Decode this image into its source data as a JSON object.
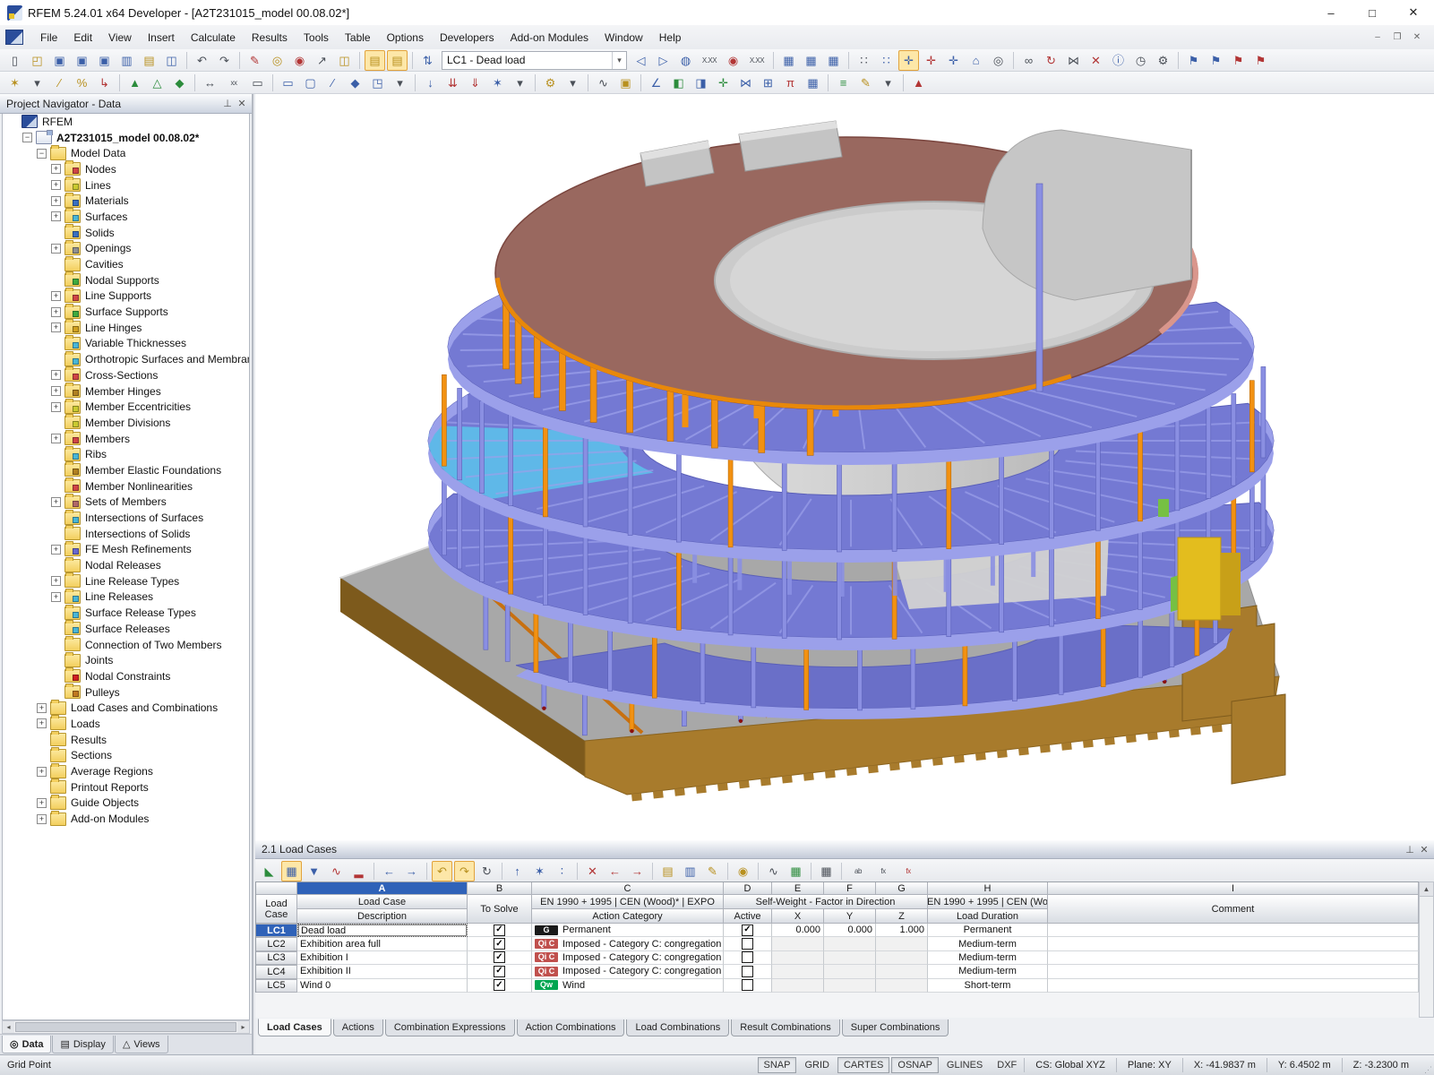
{
  "window": {
    "title": "RFEM 5.24.01 x64 Developer - [A2T231015_model 00.08.02*]",
    "controls": {
      "minimize": "–",
      "maximize": "□",
      "close": "✕"
    }
  },
  "menu": {
    "items": [
      "File",
      "Edit",
      "View",
      "Insert",
      "Calculate",
      "Results",
      "Tools",
      "Table",
      "Options",
      "Developers",
      "Add-on Modules",
      "Window",
      "Help"
    ]
  },
  "toolbar_main": {
    "combo_value": "LC1 - Dead load",
    "row1": [
      {
        "n": "new-file",
        "g": "▯",
        "c": "k"
      },
      {
        "n": "open-file",
        "g": "◰",
        "c": "y"
      },
      {
        "n": "save",
        "g": "▣",
        "c": "b"
      },
      {
        "n": "save-as",
        "g": "▣",
        "c": "b"
      },
      {
        "n": "save-all",
        "g": "▣",
        "c": "b"
      },
      {
        "n": "print",
        "g": "▥",
        "c": "b"
      },
      {
        "n": "copy",
        "g": "▤",
        "c": "y"
      },
      {
        "n": "print-preview",
        "g": "◫",
        "c": "b"
      },
      {
        "sep": 1
      },
      {
        "n": "undo",
        "g": "↶",
        "c": "k"
      },
      {
        "n": "redo",
        "g": "↷",
        "c": "k"
      },
      {
        "sep": 1
      },
      {
        "n": "edit-mode",
        "g": "✎",
        "c": "r"
      },
      {
        "n": "zoom-window",
        "g": "◎",
        "c": "y"
      },
      {
        "n": "zoom-point",
        "g": "◉",
        "c": "r"
      },
      {
        "n": "pick-objects",
        "g": "↗",
        "c": "k"
      },
      {
        "n": "new-window",
        "g": "◫",
        "c": "y"
      },
      {
        "sep": 1
      },
      {
        "n": "table-show",
        "g": "▤",
        "c": "y",
        "p": 1
      },
      {
        "n": "table-dock",
        "g": "▤",
        "c": "y",
        "p": 1
      },
      {
        "sep": 1
      },
      {
        "n": "loadcase-jump",
        "g": "⇅",
        "c": "b"
      },
      {
        "combo": 1
      },
      {
        "n": "prev-loadcase",
        "g": "◁",
        "c": "b"
      },
      {
        "n": "next-loadcase",
        "g": "▷",
        "c": "b"
      },
      {
        "n": "show-loads",
        "g": "◍",
        "c": "b"
      },
      {
        "n": "load-values",
        "g": "X.XX",
        "c": "k",
        "t": 1
      },
      {
        "n": "show-results",
        "g": "◉",
        "c": "r"
      },
      {
        "n": "result-values",
        "g": "X.XX",
        "c": "k",
        "t": 1
      },
      {
        "sep": 1
      },
      {
        "n": "panel-1",
        "g": "▦",
        "c": "b"
      },
      {
        "n": "panel-2",
        "g": "▦",
        "c": "b"
      },
      {
        "n": "panel-3",
        "g": "▦",
        "c": "b"
      },
      {
        "sep": 1
      },
      {
        "n": "fe-mesh",
        "g": "∷",
        "c": "k"
      },
      {
        "n": "fe-mesh-settings",
        "g": "∷",
        "c": "b"
      },
      {
        "n": "move-snap",
        "g": "✛",
        "c": "b",
        "p": 1
      },
      {
        "n": "move-grid",
        "g": "✛",
        "c": "r"
      },
      {
        "n": "move-object",
        "g": "✛",
        "c": "b"
      },
      {
        "n": "work-plane",
        "g": "⌂",
        "c": "b"
      },
      {
        "n": "plane-settings",
        "g": "◎",
        "c": "k"
      },
      {
        "sep": 1
      },
      {
        "n": "connect-members",
        "g": "∞",
        "c": "k"
      },
      {
        "n": "rotate-copy",
        "g": "↻",
        "c": "r"
      },
      {
        "n": "mirror",
        "g": "⋈",
        "c": "k"
      },
      {
        "n": "delete-results",
        "g": "✕",
        "c": "r"
      },
      {
        "n": "info",
        "g": "ⓘ",
        "c": "b"
      },
      {
        "n": "history",
        "g": "◷",
        "c": "k"
      },
      {
        "n": "settings-gears",
        "g": "⚙",
        "c": "k"
      },
      {
        "sep": 1
      },
      {
        "n": "import-load-1",
        "g": "⚑",
        "c": "b"
      },
      {
        "n": "import-load-2",
        "g": "⚑",
        "c": "b"
      },
      {
        "n": "export-load-1",
        "g": "⚑",
        "c": "r"
      },
      {
        "n": "export-load-2",
        "g": "⚑",
        "c": "r"
      }
    ],
    "row2": [
      {
        "n": "new-node",
        "g": "✶",
        "c": "y"
      },
      {
        "n": "new-node-dd",
        "g": "▾",
        "c": "k"
      },
      {
        "n": "new-line",
        "g": "∕",
        "c": "y"
      },
      {
        "n": "divide-line",
        "g": "%",
        "c": "y"
      },
      {
        "n": "line-polyline",
        "g": "↳",
        "c": "r"
      },
      {
        "sep": 1
      },
      {
        "n": "nodal-support",
        "g": "▲",
        "c": "g"
      },
      {
        "n": "line-support",
        "g": "△",
        "c": "g"
      },
      {
        "n": "surface-support",
        "g": "◆",
        "c": "g"
      },
      {
        "sep": 1
      },
      {
        "n": "dimension",
        "g": "↔",
        "c": "k"
      },
      {
        "n": "dimension-xx",
        "g": "xx",
        "c": "k",
        "t": 1
      },
      {
        "n": "selection-box",
        "g": "▭",
        "c": "k"
      },
      {
        "sep": 1
      },
      {
        "n": "new-surface",
        "g": "▭",
        "c": "b"
      },
      {
        "n": "new-opening",
        "g": "▢",
        "c": "b"
      },
      {
        "n": "new-member",
        "g": "∕",
        "c": "b"
      },
      {
        "n": "new-solid",
        "g": "◆",
        "c": "b"
      },
      {
        "n": "copy-object",
        "g": "◳",
        "c": "b"
      },
      {
        "n": "copy-dd",
        "g": "▾",
        "c": "k"
      },
      {
        "sep": 1
      },
      {
        "n": "nodal-load",
        "g": "↓",
        "c": "b"
      },
      {
        "n": "member-load",
        "g": "⇊",
        "c": "r"
      },
      {
        "n": "surface-load",
        "g": "⇓",
        "c": "r"
      },
      {
        "n": "generate-loads",
        "g": "✶",
        "c": "b"
      },
      {
        "n": "loads-dd",
        "g": "▾",
        "c": "k"
      },
      {
        "sep": 1
      },
      {
        "n": "tools-axes",
        "g": "⚙",
        "c": "y"
      },
      {
        "n": "tools-dd",
        "g": "▾",
        "c": "k"
      },
      {
        "sep": 1
      },
      {
        "n": "guide-line",
        "g": "∿",
        "c": "k"
      },
      {
        "n": "stamp",
        "g": "▣",
        "c": "y"
      },
      {
        "sep": 1
      },
      {
        "n": "measure",
        "g": "∠",
        "c": "b"
      },
      {
        "n": "render-surface",
        "g": "◧",
        "c": "g"
      },
      {
        "n": "render-solid",
        "g": "◨",
        "c": "b"
      },
      {
        "n": "move-arrows",
        "g": "✛",
        "c": "g"
      },
      {
        "n": "mirror-copy",
        "g": "⋈",
        "c": "b"
      },
      {
        "n": "multi-copy",
        "g": "⊞",
        "c": "b"
      },
      {
        "n": "section",
        "g": "π",
        "c": "r"
      },
      {
        "n": "table-view",
        "g": "▦",
        "c": "b"
      },
      {
        "sep": 1
      },
      {
        "n": "display-list",
        "g": "≡",
        "c": "g"
      },
      {
        "n": "format-brush",
        "g": "✎",
        "c": "y"
      },
      {
        "n": "brush-dd",
        "g": "▾",
        "c": "k"
      },
      {
        "sep": 1
      },
      {
        "n": "color-scale",
        "g": "▲",
        "c": "r"
      }
    ]
  },
  "navigator": {
    "title": "Project Navigator - Data",
    "pin_icon": "⊥",
    "close_icon": "✕",
    "tree": [
      [
        0,
        "RFEM",
        "none",
        "rfem",
        0
      ],
      [
        1,
        "A2T231015_model 00.08.02*",
        "minus",
        "model",
        1
      ],
      [
        2,
        "Model Data",
        "minus",
        "folderOpen",
        0
      ],
      [
        3,
        "Nodes",
        "plus",
        "nodes",
        0
      ],
      [
        3,
        "Lines",
        "plus",
        "lines",
        0
      ],
      [
        3,
        "Materials",
        "plus",
        "materials",
        0
      ],
      [
        3,
        "Surfaces",
        "plus",
        "surfaces",
        0
      ],
      [
        3,
        "Solids",
        "none",
        "solids",
        0
      ],
      [
        3,
        "Openings",
        "plus",
        "openings",
        0
      ],
      [
        3,
        "Cavities",
        "none",
        "folder",
        0
      ],
      [
        3,
        "Nodal Supports",
        "none",
        "nodalSup",
        0
      ],
      [
        3,
        "Line Supports",
        "plus",
        "lineSup",
        0
      ],
      [
        3,
        "Surface Supports",
        "plus",
        "surfSup",
        0
      ],
      [
        3,
        "Line Hinges",
        "plus",
        "lineHinge",
        0
      ],
      [
        3,
        "Variable Thicknesses",
        "none",
        "varThick",
        0
      ],
      [
        3,
        "Orthotropic Surfaces and Membranes",
        "none",
        "ortho",
        0
      ],
      [
        3,
        "Cross-Sections",
        "plus",
        "cross",
        0
      ],
      [
        3,
        "Member Hinges",
        "plus",
        "memberHinge",
        0
      ],
      [
        3,
        "Member Eccentricities",
        "plus",
        "memberEcc",
        0
      ],
      [
        3,
        "Member Divisions",
        "none",
        "memberDiv",
        0
      ],
      [
        3,
        "Members",
        "plus",
        "members",
        0
      ],
      [
        3,
        "Ribs",
        "none",
        "ribs",
        0
      ],
      [
        3,
        "Member Elastic Foundations",
        "none",
        "elasticFound",
        0
      ],
      [
        3,
        "Member Nonlinearities",
        "none",
        "nonlin",
        0
      ],
      [
        3,
        "Sets of Members",
        "plus",
        "sets",
        0
      ],
      [
        3,
        "Intersections of Surfaces",
        "none",
        "interSurf",
        0
      ],
      [
        3,
        "Intersections of Solids",
        "none",
        "interSolid",
        0
      ],
      [
        3,
        "FE Mesh Refinements",
        "plus",
        "femesh",
        0
      ],
      [
        3,
        "Nodal Releases",
        "none",
        "nodalRel",
        0
      ],
      [
        3,
        "Line Release Types",
        "plus",
        "lineRelT",
        0
      ],
      [
        3,
        "Line Releases",
        "plus",
        "lineRel",
        0
      ],
      [
        3,
        "Surface Release Types",
        "none",
        "surfRelT",
        0
      ],
      [
        3,
        "Surface Releases",
        "none",
        "surfRel",
        0
      ],
      [
        3,
        "Connection of Two Members",
        "none",
        "conn2",
        0
      ],
      [
        3,
        "Joints",
        "none",
        "joints",
        0
      ],
      [
        3,
        "Nodal Constraints",
        "none",
        "nodalConstr",
        0
      ],
      [
        3,
        "Pulleys",
        "none",
        "pulleys",
        0
      ],
      [
        2,
        "Load Cases and Combinations",
        "plus",
        "folder",
        0
      ],
      [
        2,
        "Loads",
        "plus",
        "folder",
        0
      ],
      [
        2,
        "Results",
        "none",
        "folder",
        0
      ],
      [
        2,
        "Sections",
        "none",
        "folder",
        0
      ],
      [
        2,
        "Average Regions",
        "plus",
        "folder",
        0
      ],
      [
        2,
        "Printout Reports",
        "none",
        "folder",
        0
      ],
      [
        2,
        "Guide Objects",
        "plus",
        "folder",
        0
      ],
      [
        2,
        "Add-on Modules",
        "plus",
        "folder",
        0
      ]
    ],
    "tabs": [
      {
        "label": "Data",
        "icon": "◎",
        "active": true
      },
      {
        "label": "Display",
        "icon": "▤",
        "active": false
      },
      {
        "label": "Views",
        "icon": "△",
        "active": false
      }
    ]
  },
  "viewport": {
    "colors": {
      "roof": "#99685f",
      "roof_rim_orange": "#e8880a",
      "roof_rim_salmon": "#d9968c",
      "roof_edge_dark": "#7a453e",
      "slab": "#7479d3",
      "slab_dark": "#6a6fc8",
      "slab_edge": "#9ba0ea",
      "slab_light": "#5fb8e8",
      "column_blue": "#8a8fe2",
      "column_orange": "#f29111",
      "core": "#c9c9c9",
      "core_light": "#dedede",
      "core_dark": "#b4b4b4",
      "base_top": "#a8a8a8",
      "base_wood": "#a87b2c",
      "base_wood_dark": "#7d5a1c",
      "accent_green": "#76c043",
      "accent_yellow": "#e3bd1e",
      "node_red": "#8a1010"
    }
  },
  "load_cases_panel": {
    "title": "2.1 Load Cases",
    "pin_icon": "⊥",
    "close_icon": "✕",
    "toolbar": [
      {
        "n": "table-settings",
        "g": "◣",
        "c": "g"
      },
      {
        "n": "table-filter",
        "g": "▦",
        "c": "b",
        "p": 1
      },
      {
        "n": "table-rows",
        "g": "▼",
        "c": "b"
      },
      {
        "n": "table-diagram",
        "g": "∿",
        "c": "r"
      },
      {
        "n": "table-stats",
        "g": "▂",
        "c": "r"
      },
      {
        "sep": 1
      },
      {
        "n": "col-prev",
        "g": "←",
        "c": "b"
      },
      {
        "n": "col-next",
        "g": "→",
        "c": "b"
      },
      {
        "sep": 1
      },
      {
        "n": "undo-table",
        "g": "↶",
        "c": "y",
        "p": 1
      },
      {
        "n": "redo-table",
        "g": "↷",
        "c": "y",
        "p": 1
      },
      {
        "n": "refresh-table",
        "g": "↻",
        "c": "k"
      },
      {
        "sep": 1
      },
      {
        "n": "row-up",
        "g": "↑",
        "c": "b"
      },
      {
        "n": "row-generate",
        "g": "✶",
        "c": "b"
      },
      {
        "n": "row-detail",
        "g": "∶",
        "c": "b"
      },
      {
        "sep": 1
      },
      {
        "n": "clear-table",
        "g": "✕",
        "c": "r"
      },
      {
        "n": "delete-row",
        "g": "←",
        "c": "r"
      },
      {
        "n": "insert-row",
        "g": "→",
        "c": "r"
      },
      {
        "sep": 1
      },
      {
        "n": "view-sheet",
        "g": "▤",
        "c": "y"
      },
      {
        "n": "view-sheets",
        "g": "▥",
        "c": "b"
      },
      {
        "n": "edit-comment",
        "g": "✎",
        "c": "y"
      },
      {
        "sep": 1
      },
      {
        "n": "find-in-table",
        "g": "◉",
        "c": "y"
      },
      {
        "sep": 1
      },
      {
        "n": "diagram-curve",
        "g": "∿",
        "c": "k"
      },
      {
        "n": "excel-export",
        "g": "▦",
        "c": "g"
      },
      {
        "sep": 1
      },
      {
        "n": "calculator",
        "g": "▦",
        "c": "k"
      },
      {
        "sep": 1
      },
      {
        "n": "spell-check",
        "g": "ab",
        "c": "k",
        "t": 1
      },
      {
        "n": "formula-fx",
        "g": "fx",
        "c": "k",
        "t": 1
      },
      {
        "n": "formula-delete",
        "g": "fx",
        "c": "r",
        "t": 1
      }
    ],
    "table": {
      "corner": [
        "Load",
        "Case"
      ],
      "letters": [
        "A",
        "B",
        "C",
        "D",
        "E",
        "F",
        "G",
        "H",
        "I"
      ],
      "selected_letter": "A",
      "group_a": "Load Case",
      "group_c": "EN 1990 + 1995 | CEN (Wood)* | EXPO",
      "group_defg": "Self-Weight  -  Factor in Direction",
      "group_h": "EN 1990 + 1995 | CEN (Wo",
      "sub": {
        "a": "Description",
        "b": "To Solve",
        "c": "Action Category",
        "d": "Active",
        "e": "X",
        "f": "Y",
        "g": "Z",
        "h": "Load Duration",
        "i": "Comment"
      },
      "rows": [
        {
          "id": "LC1",
          "description": "Dead load",
          "to_solve": true,
          "badge": "G",
          "badge_color": "#1a1a1a",
          "category": "Permanent",
          "active": true,
          "x": "0.000",
          "y": "0.000",
          "z": "1.000",
          "duration": "Permanent",
          "comment": "",
          "selected": true
        },
        {
          "id": "LC2",
          "description": "Exhibition area full",
          "to_solve": true,
          "badge": "Qi C",
          "badge_color": "#c0504d",
          "category": "Imposed - Category C: congregation are",
          "active": false,
          "x": "",
          "y": "",
          "z": "",
          "duration": "Medium-term",
          "comment": "",
          "selected": false
        },
        {
          "id": "LC3",
          "description": "Exhibition I",
          "to_solve": true,
          "badge": "Qi C",
          "badge_color": "#c0504d",
          "category": "Imposed - Category C: congregation are",
          "active": false,
          "x": "",
          "y": "",
          "z": "",
          "duration": "Medium-term",
          "comment": "",
          "selected": false
        },
        {
          "id": "LC4",
          "description": "Exhibition II",
          "to_solve": true,
          "badge": "Qi C",
          "badge_color": "#c0504d",
          "category": "Imposed - Category C: congregation are",
          "active": false,
          "x": "",
          "y": "",
          "z": "",
          "duration": "Medium-term",
          "comment": "",
          "selected": false
        },
        {
          "id": "LC5",
          "description": "Wind 0",
          "to_solve": true,
          "badge": "Qw",
          "badge_color": "#00a651",
          "category": "Wind",
          "active": false,
          "x": "",
          "y": "",
          "z": "",
          "duration": "Short-term",
          "comment": "",
          "selected": false
        }
      ]
    },
    "tabs": [
      {
        "label": "Load Cases",
        "active": true
      },
      {
        "label": "Actions",
        "active": false
      },
      {
        "label": "Combination Expressions",
        "active": false
      },
      {
        "label": "Action Combinations",
        "active": false
      },
      {
        "label": "Load Combinations",
        "active": false
      },
      {
        "label": "Result Combinations",
        "active": false
      },
      {
        "label": "Super Combinations",
        "active": false
      }
    ]
  },
  "statusbar": {
    "left_text": "Grid Point",
    "toggles": [
      {
        "label": "SNAP",
        "active": true
      },
      {
        "label": "GRID",
        "active": false
      },
      {
        "label": "CARTES",
        "active": true
      },
      {
        "label": "OSNAP",
        "active": true
      },
      {
        "label": "GLINES",
        "active": false
      },
      {
        "label": "DXF",
        "active": false
      }
    ],
    "cs": "CS: Global XYZ",
    "plane": "Plane: XY",
    "coord_x": "X:  -41.9837 m",
    "coord_y": "Y:  6.4502 m",
    "coord_z": "Z:  -3.2300 m"
  }
}
